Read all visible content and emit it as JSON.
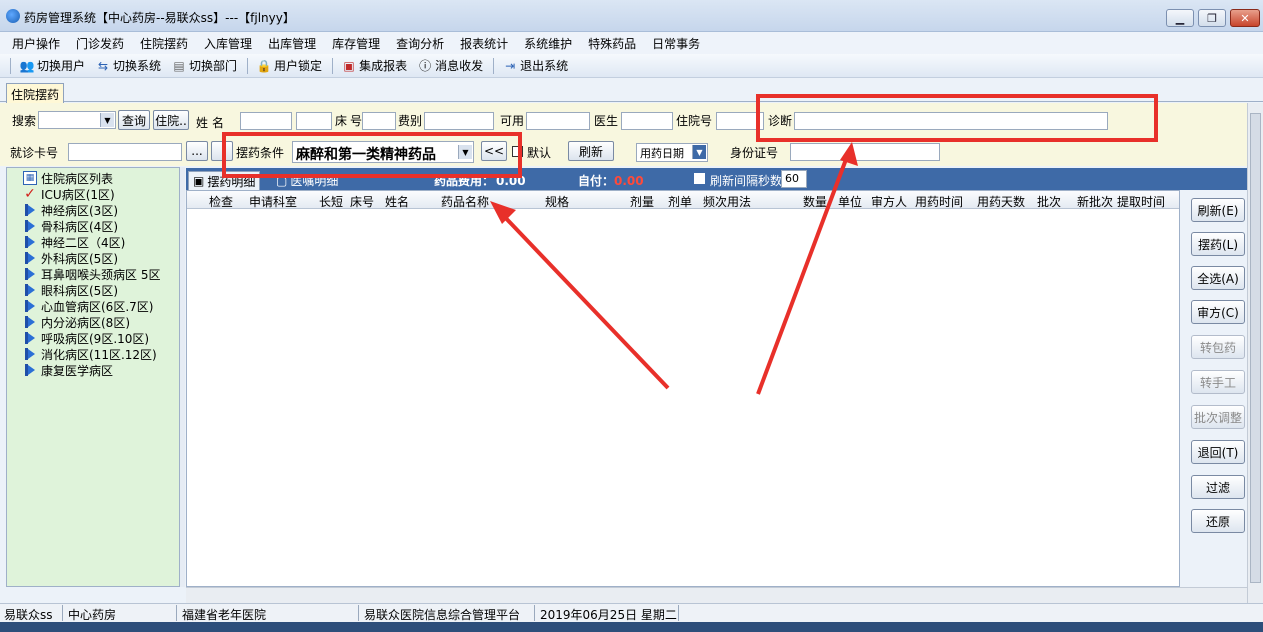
{
  "window": {
    "title": "药房管理系统【中心药房--易联众ss】---【fjlnyy】",
    "minimize": "▁",
    "maximize": "❐",
    "close": "✕"
  },
  "menu": [
    "用户操作",
    "门诊发药",
    "住院摆药",
    "入库管理",
    "出库管理",
    "库存管理",
    "查询分析",
    "报表统计",
    "系统维护",
    "特殊药品",
    "日常事务"
  ],
  "toolbar": [
    {
      "label": "切换用户",
      "icon": "users-icon"
    },
    {
      "label": "切换系统",
      "icon": "switch-system-icon"
    },
    {
      "label": "切换部门",
      "icon": "department-icon"
    },
    {
      "label": "用户锁定",
      "icon": "lock-user-icon"
    },
    {
      "label": "集成报表",
      "icon": "report-icon"
    },
    {
      "label": "消息收发",
      "icon": "message-icon"
    },
    {
      "label": "退出系统",
      "icon": "exit-icon"
    }
  ],
  "tab": {
    "label": "住院摆药"
  },
  "filters": {
    "search_label": "搜索",
    "query_button": "查询",
    "inpatient_button": "住院..",
    "name_label": "姓名",
    "bed_label": "床号",
    "fee_label": "费别",
    "available_label": "可用",
    "doctor_label": "医生",
    "inpatient_no_label": "住院号",
    "diagnosis_label": "诊断",
    "visit_card_label": "就诊卡号",
    "ellipsis_button": "...",
    "condition_label": "摆药条件",
    "condition_value": "麻醉和第一类精神药品",
    "back_button": "<<",
    "default_label": "默认",
    "refresh_button": "刷新",
    "date_select": "用药日期",
    "id_card_label": "身份证号"
  },
  "tree": {
    "root": "住院病区列表",
    "items": [
      "ICU病区(1区)",
      "神经病区(3区)",
      "骨科病区(4区)",
      "神经二区（4区)",
      "外科病区(5区)",
      "耳鼻咽喉头颈病区 5区",
      "眼科病区(5区)",
      "心血管病区(6区.7区)",
      "内分泌病区(8区)",
      "呼吸病区(9区.10区)",
      "消化病区(11区.12区)",
      "康复医学病区"
    ]
  },
  "grid_tabs": {
    "tab1": "摆药明细",
    "tab2": "医嘱明细",
    "fee_label": "药品费用：",
    "fee_value": "0.00",
    "self_pay_label": "自付：",
    "self_pay_value": "0.00",
    "interval_label": "刷新间隔秒数",
    "interval_value": "60"
  },
  "columns": [
    "检查",
    "申请科室",
    "长短",
    "床号",
    "姓名",
    "药品名称",
    "规格",
    "剂量",
    "剂单",
    "频次用法",
    "数量",
    "单位",
    "审方人",
    "用药时间",
    "用药天数",
    "批次",
    "新批次",
    "提取时间"
  ],
  "right_buttons": [
    {
      "label": "刷新(E)",
      "enabled": true
    },
    {
      "label": "摆药(L)",
      "enabled": true
    },
    {
      "label": "全选(A)",
      "enabled": true
    },
    {
      "label": "审方(C)",
      "enabled": true
    },
    {
      "label": "转包药",
      "enabled": false
    },
    {
      "label": "转手工",
      "enabled": false
    },
    {
      "label": "批次调整",
      "enabled": false
    },
    {
      "label": "退回(T)",
      "enabled": true
    },
    {
      "label": "过滤",
      "enabled": true
    },
    {
      "label": "还原",
      "enabled": true
    }
  ],
  "status": {
    "user": "易联众ss",
    "dept": "中心药房",
    "hospital": "福建省老年医院",
    "platform": "易联众医院信息综合管理平台",
    "date": "2019年06月25日 星期二"
  },
  "colors": {
    "highlight": "#e8302a",
    "tree_bg": "#dff3da",
    "filter_bg": "#f8f7df",
    "tab_bar": "#3e6aa7"
  }
}
